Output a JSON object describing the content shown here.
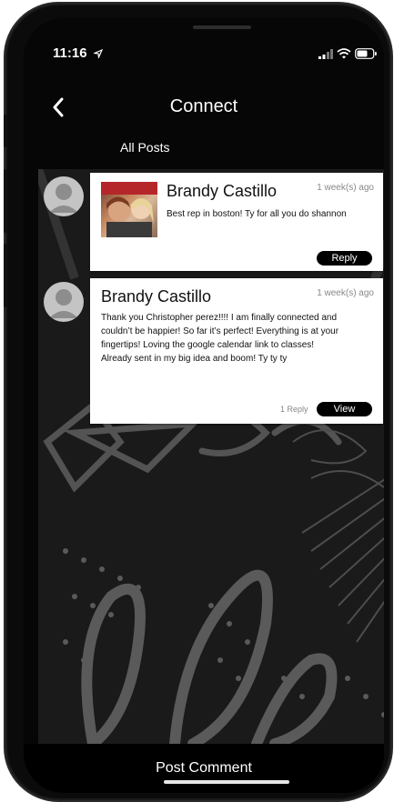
{
  "status": {
    "time": "11:16"
  },
  "header": {
    "title": "Connect",
    "tab": "All Posts"
  },
  "posts": [
    {
      "author": "Brandy Castillo",
      "time_ago": "1 week(s) ago",
      "text": "Best rep in boston! Ty for all you do shannon",
      "action_label": "Reply"
    },
    {
      "author": "Brandy Castillo",
      "time_ago": "1 week(s) ago",
      "text_lines": [
        "Thank you Christopher perez!!!! I am finally connected and",
        "couldn’t be happier! So far it’s perfect! Everything is at your",
        "fingertips! Loving the google calendar link to classes!",
        "Already sent in my big idea and boom! Ty ty ty"
      ],
      "replies": "1 Reply",
      "action_label": "View"
    }
  ],
  "footer": {
    "post_comment": "Post Comment"
  },
  "colors": {
    "accent": "#000000",
    "card": "#ffffff",
    "background": "#1a1a1a"
  }
}
